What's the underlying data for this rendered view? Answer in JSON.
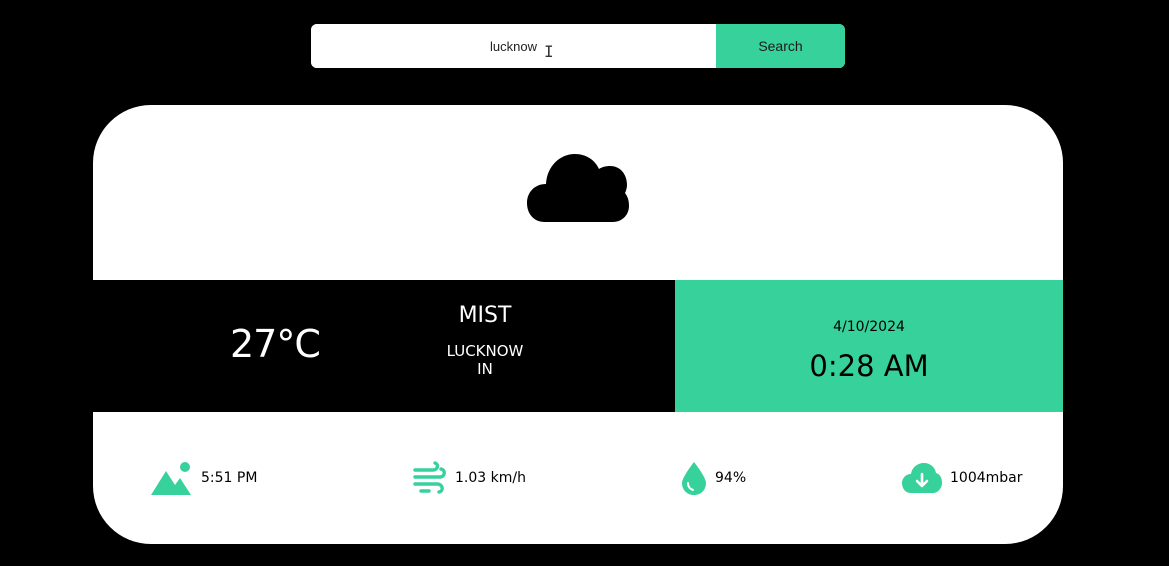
{
  "search": {
    "value": "lucknow",
    "button_label": "Search"
  },
  "weather": {
    "icon": "cloud-icon",
    "temperature": "27°C",
    "condition": "MIST",
    "city": "LUCKNOW",
    "country": "IN"
  },
  "datetime": {
    "date": "4/10/2024",
    "time": "0:28 AM"
  },
  "stats": {
    "sunset": {
      "icon": "mountain-sun-icon",
      "value": "5:51 PM"
    },
    "wind": {
      "icon": "wind-icon",
      "value": "1.03 km/h"
    },
    "humidity": {
      "icon": "droplet-icon",
      "value": "94%"
    },
    "pressure": {
      "icon": "cloud-download-icon",
      "value": "1004mbar"
    }
  },
  "colors": {
    "accent": "#37d19c",
    "background": "#000000",
    "card": "#ffffff"
  }
}
